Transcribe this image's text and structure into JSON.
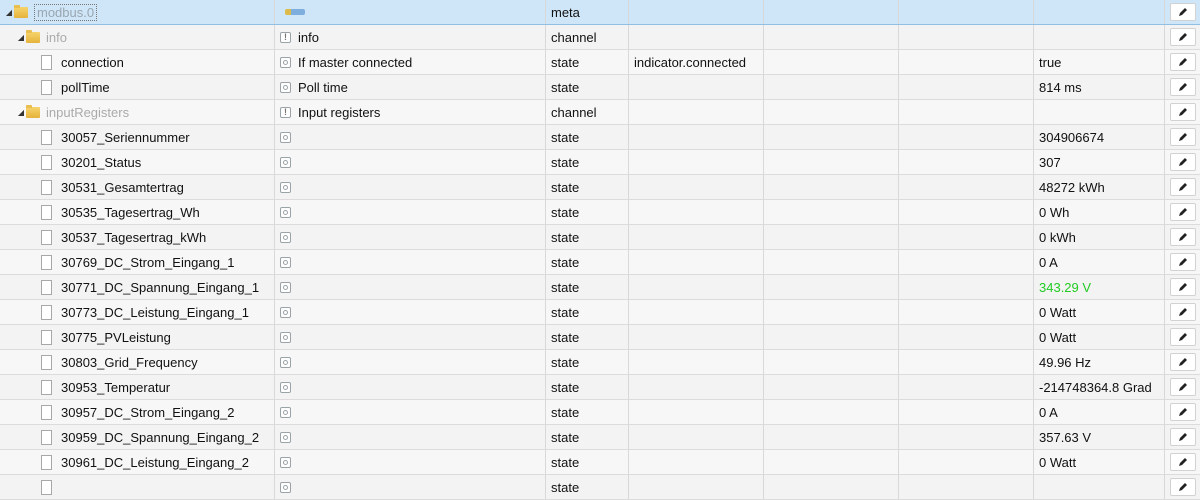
{
  "tree": {
    "root": {
      "name": "modbus.0",
      "title_icon": "adapter-logo-icon",
      "type": "meta"
    },
    "info": {
      "name": "info",
      "title": "info",
      "type": "channel"
    },
    "connection": {
      "name": "connection",
      "title": "If master connected",
      "type": "state",
      "role": "indicator.connected",
      "value": "true"
    },
    "pollTime": {
      "name": "pollTime",
      "title": "Poll time",
      "type": "state",
      "value": "814 ms"
    },
    "inputRegisters": {
      "name": "inputRegisters",
      "title": "Input registers",
      "type": "channel"
    },
    "registers": [
      {
        "name": "30057_Seriennummer",
        "type": "state",
        "value": "304906674"
      },
      {
        "name": "30201_Status",
        "type": "state",
        "value": "307"
      },
      {
        "name": "30531_Gesamtertrag",
        "type": "state",
        "value": "48272 kWh"
      },
      {
        "name": "30535_Tagesertrag_Wh",
        "type": "state",
        "value": "0 Wh"
      },
      {
        "name": "30537_Tagesertrag_kWh",
        "type": "state",
        "value": "0 kWh"
      },
      {
        "name": "30769_DC_Strom_Eingang_1",
        "type": "state",
        "value": "0 A"
      },
      {
        "name": "30771_DC_Spannung_Eingang_1",
        "type": "state",
        "value": "343.29 V"
      },
      {
        "name": "30773_DC_Leistung_Eingang_1",
        "type": "state",
        "value": "0 Watt"
      },
      {
        "name": "30775_PVLeistung",
        "type": "state",
        "value": "0 Watt"
      },
      {
        "name": "30803_Grid_Frequency",
        "type": "state",
        "value": "49.96 Hz"
      },
      {
        "name": "30953_Temperatur",
        "type": "state",
        "value": "-214748364.8 Grad"
      },
      {
        "name": "30957_DC_Strom_Eingang_2",
        "type": "state",
        "value": "0 A"
      },
      {
        "name": "30959_DC_Spannung_Eingang_2",
        "type": "state",
        "value": "357.63 V"
      },
      {
        "name": "30961_DC_Leistung_Eingang_2",
        "type": "state",
        "value": "0 Watt"
      },
      {
        "name": "",
        "type": "state",
        "value": ""
      }
    ]
  },
  "colors": {
    "selected_row": "#cfe6f8",
    "highlight_value": "#22cc22",
    "folder": "#e6b23c"
  }
}
